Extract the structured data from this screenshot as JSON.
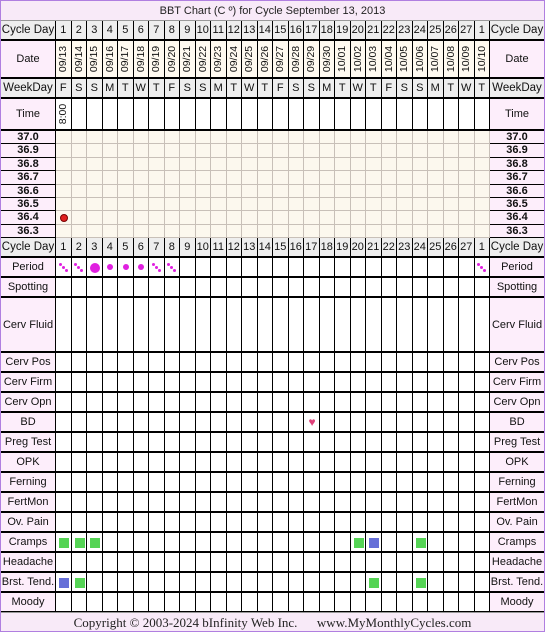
{
  "title": "BBT Chart (C º) for Cycle September 13, 2013",
  "colors": {
    "period": "#e020e0",
    "temp_dot": "#e02020",
    "heart": "#e0407a",
    "green": "#55d455",
    "blue": "#6670d8"
  },
  "chart_data": {
    "type": "table",
    "title": "BBT Chart (C º) for Cycle September 13, 2013",
    "cycle_days": [
      "1",
      "2",
      "3",
      "4",
      "5",
      "6",
      "7",
      "8",
      "9",
      "10",
      "11",
      "12",
      "13",
      "14",
      "15",
      "16",
      "17",
      "18",
      "19",
      "20",
      "21",
      "22",
      "23",
      "24",
      "25",
      "26",
      "27",
      "1"
    ],
    "dates": [
      "09/13",
      "09/14",
      "09/15",
      "09/16",
      "09/17",
      "09/18",
      "09/19",
      "09/20",
      "09/21",
      "09/22",
      "09/23",
      "09/24",
      "09/25",
      "09/26",
      "09/27",
      "09/28",
      "09/29",
      "09/30",
      "10/01",
      "10/02",
      "10/03",
      "10/04",
      "10/05",
      "10/06",
      "10/07",
      "10/08",
      "10/09",
      "10/10"
    ],
    "weekdays": [
      "F",
      "S",
      "S",
      "M",
      "T",
      "W",
      "T",
      "F",
      "S",
      "S",
      "M",
      "T",
      "W",
      "T",
      "F",
      "S",
      "S",
      "M",
      "T",
      "W",
      "T",
      "F",
      "S",
      "S",
      "M",
      "T",
      "W",
      "T"
    ],
    "times": [
      "8:00",
      "",
      "",
      "",
      "",
      "",
      "",
      "",
      "",
      "",
      "",
      "",
      "",
      "",
      "",
      "",
      "",
      "",
      "",
      "",
      "",
      "",
      "",
      "",
      "",
      "",
      "",
      ""
    ],
    "temp_axis": [
      "37.0",
      "36.9",
      "36.8",
      "36.7",
      "36.6",
      "36.5",
      "36.4",
      "36.3"
    ],
    "ylim": [
      36.3,
      37.0
    ],
    "temperatures": [
      36.4,
      null,
      null,
      null,
      null,
      null,
      null,
      null,
      null,
      null,
      null,
      null,
      null,
      null,
      null,
      null,
      null,
      null,
      null,
      null,
      null,
      null,
      null,
      null,
      null,
      null,
      null,
      null
    ],
    "period": [
      "spotting-dots",
      "spotting-dots",
      "heavy",
      "medium",
      "medium",
      "medium",
      "spotting-dots",
      "spotting-dots",
      "",
      "",
      "",
      "",
      "",
      "",
      "",
      "",
      "",
      "",
      "",
      "",
      "",
      "",
      "",
      "",
      "",
      "",
      "",
      "spotting-dots"
    ],
    "bd_days": [
      17
    ],
    "cramps": {
      "green": [
        1,
        2,
        3,
        20,
        24
      ],
      "blue": [
        21
      ]
    },
    "breast_tenderness": {
      "green": [
        2,
        21,
        24
      ],
      "blue": [
        1
      ]
    }
  },
  "row_labels": {
    "cycle_day": "Cycle Day",
    "date": "Date",
    "weekday": "WeekDay",
    "time": "Time",
    "period": "Period",
    "spotting": "Spotting",
    "cerv_fluid": "Cerv Fluid",
    "cerv_pos": "Cerv Pos",
    "cerv_firm": "Cerv Firm",
    "cerv_opn": "Cerv Opn",
    "bd": "BD",
    "preg_test": "Preg Test",
    "opk": "OPK",
    "ferning": "Ferning",
    "fertmon": "FertMon",
    "ov_pain": "Ov. Pain",
    "cramps": "Cramps",
    "headache": "Headache",
    "brst_tend": "Brst. Tend.",
    "moody": "Moody"
  },
  "footer": {
    "copyright": "Copyright © 2003-2024 bInfinity Web Inc.",
    "site": "www.MyMonthlyCycles.com"
  }
}
